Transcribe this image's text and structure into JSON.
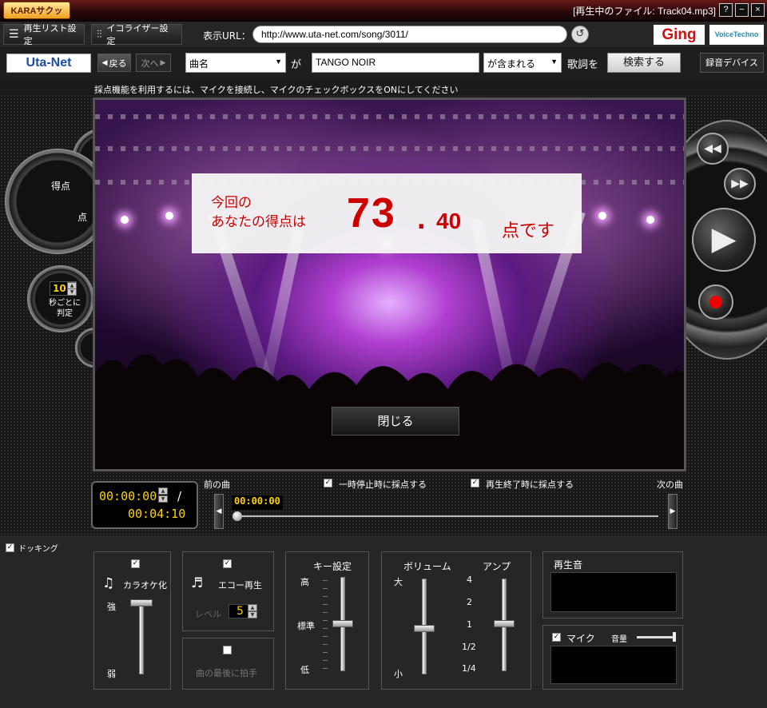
{
  "titlebar": {
    "logo_text": "KARAサクッ",
    "now_playing": "[再生中のファイル: Track04.mp3]",
    "help": "?",
    "minimize": "−",
    "close": "×"
  },
  "toolbar1": {
    "playlist_label": "再生リスト設定",
    "equalizer_label": "イコライザー設定",
    "url_label": "表示URL：",
    "url_value": "http://www.uta-net.com/song/3011/",
    "ging": "Ging",
    "voicetechno": "VoiceTechno"
  },
  "toolbar2": {
    "utanet": "Uta-Net",
    "back": "戻る",
    "next": "次へ",
    "field_select": "曲名",
    "ga": "が",
    "query": "TANGO NOIR",
    "match_select": "が含まれる",
    "lyrics_wo": "歌詞を",
    "search": "検索する",
    "rec_device": "録音デバイス"
  },
  "notice": "採点機能を利用するには、マイクを接続し、マイクのチェックボックスをONにしてください",
  "score": {
    "line1": "今回の",
    "line2": "あなたの得点は",
    "integer": "73",
    "dot": ".",
    "decimal": "40",
    "unit": "点です",
    "close": "閉じる"
  },
  "left_dial": {
    "label": "得点",
    "unit": "点",
    "interval_value": "10",
    "interval_label": "秒ごとに判定"
  },
  "player": {
    "current_time": "00:00:00",
    "separator": "/",
    "total_time": "00:04:10",
    "prev": "前の曲",
    "next": "次の曲",
    "score_on_pause": "一時停止時に採点する",
    "score_on_end": "再生終了時に採点する",
    "seek_time": "00:00:00",
    "progress": 0
  },
  "bottom": {
    "docking": "ドッキング",
    "karaoke": "カラオケ化",
    "strong": "強",
    "weak": "弱",
    "echo": "エコー再生",
    "level": "レベル",
    "level_value": "5",
    "applause": "曲の最後に拍手",
    "key_title": "キー設定",
    "key_high": "高",
    "key_std": "標準",
    "key_low": "低",
    "volume_title": "ボリューム",
    "vol_big": "大",
    "vol_small": "小",
    "amp_title": "アンプ",
    "amp_ticks": [
      "4",
      "2",
      "1",
      "1/2",
      "1/4"
    ],
    "playback_sound": "再生音",
    "mic": "マイク",
    "mic_volume": "音量"
  }
}
